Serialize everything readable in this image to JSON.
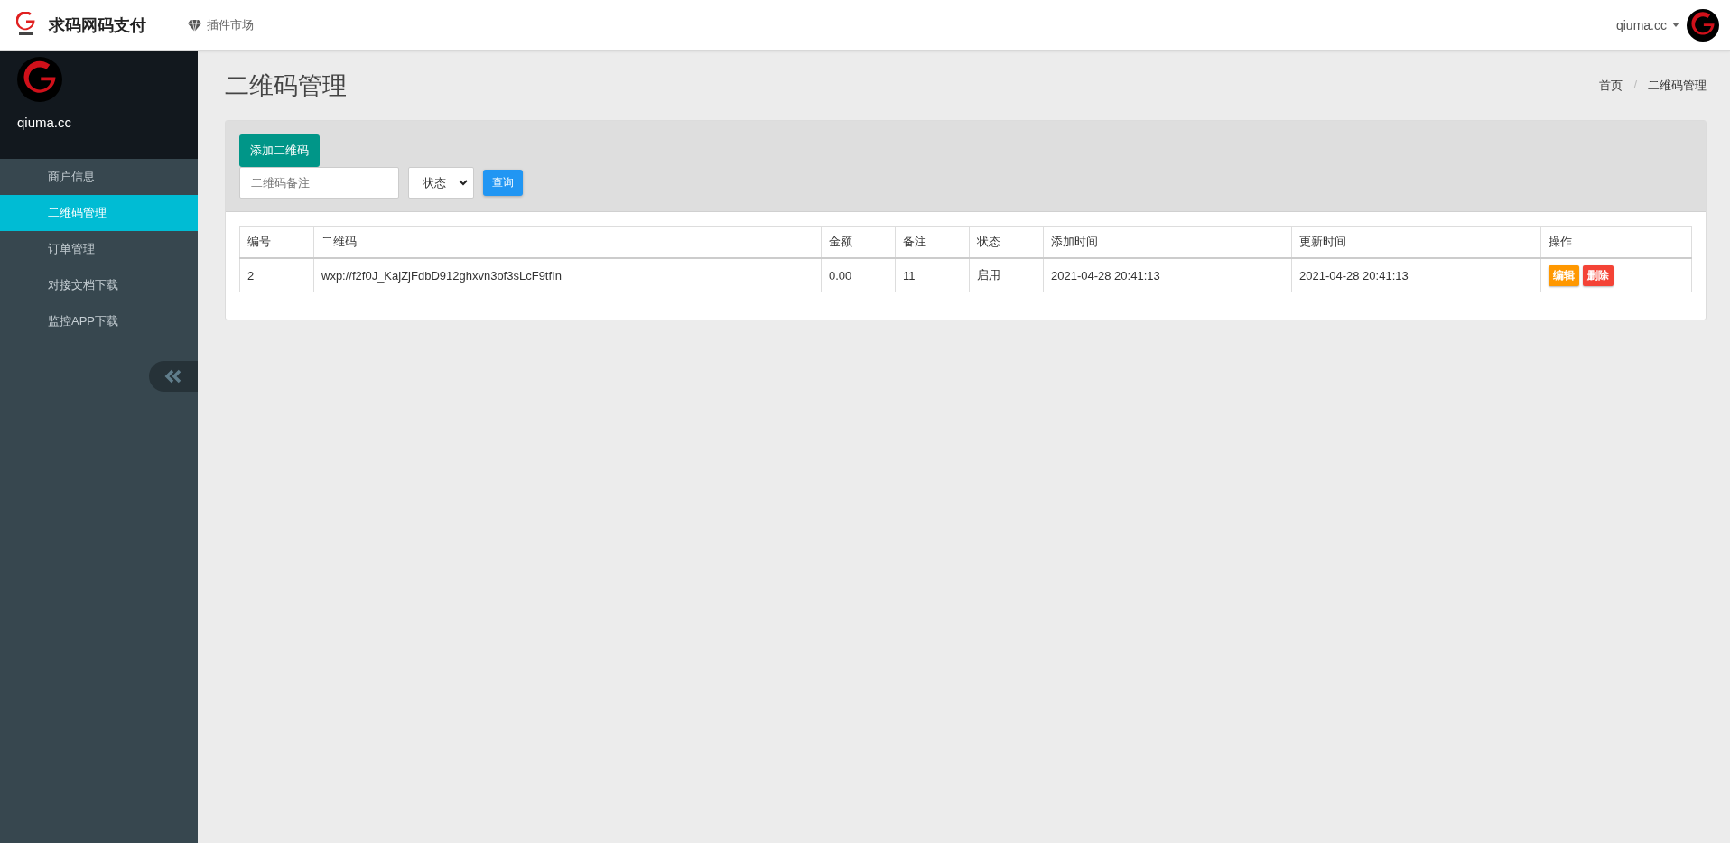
{
  "topbar": {
    "brand": "求码网码支付",
    "nav": [
      {
        "label": "插件市场"
      }
    ],
    "user": "qiuma.cc"
  },
  "sidebar": {
    "username": "qiuma.cc",
    "items": [
      {
        "label": "商户信息",
        "selected": false
      },
      {
        "label": "二维码管理",
        "selected": true
      },
      {
        "label": "订单管理",
        "selected": false
      },
      {
        "label": "对接文档下载",
        "selected": false
      },
      {
        "label": "监控APP下载",
        "selected": false
      }
    ]
  },
  "page": {
    "title": "二维码管理",
    "breadcrumb": [
      "首页",
      "/",
      "二维码管理"
    ]
  },
  "toolbar": {
    "add_button": "添加二维码",
    "remark_field": {
      "placeholder": "二维码备注"
    },
    "status_select": {
      "value": "状态"
    },
    "query_button": "查询"
  },
  "table": {
    "columns": [
      "编号",
      "二维码",
      "金额",
      "备注",
      "状态",
      "添加时间",
      "更新时间",
      "操作"
    ],
    "rows": [
      {
        "cells": [
          "2",
          "wxp://f2f0J_KajZjFdbD912ghxvn3of3sLcF9tfIn",
          "0.00",
          "11",
          "启用",
          "2021-04-28 20:41:13",
          "2021-04-28 20:41:13"
        ],
        "actions": [
          {
            "label": "编辑",
            "kind": "edit"
          },
          {
            "label": "删除",
            "kind": "delete"
          }
        ]
      }
    ]
  }
}
